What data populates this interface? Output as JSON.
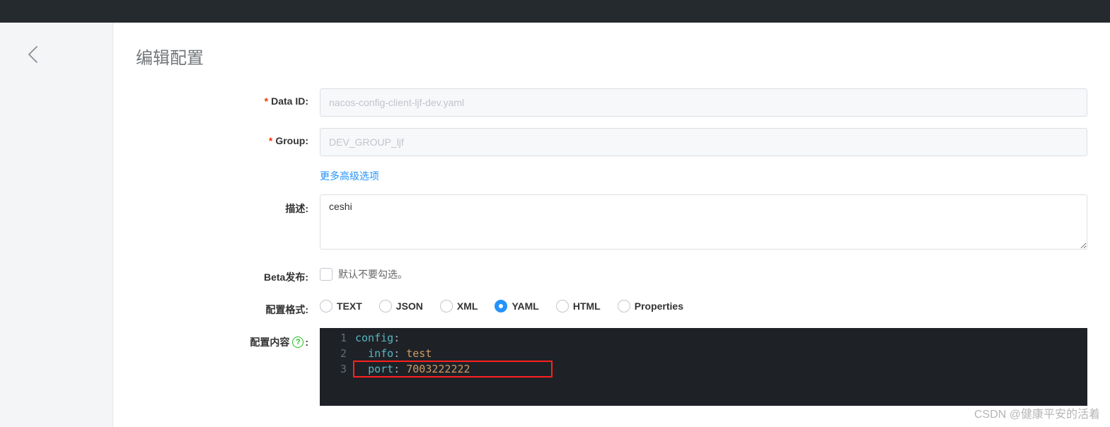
{
  "page": {
    "title": "编辑配置"
  },
  "form": {
    "dataId": {
      "label": "Data ID:",
      "value": "nacos-config-client-ljf-dev.yaml"
    },
    "group": {
      "label": "Group:",
      "value": "DEV_GROUP_ljf"
    },
    "advancedLink": "更多高级选项",
    "description": {
      "label": "描述:",
      "value": "ceshi"
    },
    "beta": {
      "label": "Beta发布:",
      "hint": "默认不要勾选。"
    },
    "format": {
      "label": "配置格式:",
      "options": [
        {
          "value": "TEXT",
          "checked": false
        },
        {
          "value": "JSON",
          "checked": false
        },
        {
          "value": "XML",
          "checked": false
        },
        {
          "value": "YAML",
          "checked": true
        },
        {
          "value": "HTML",
          "checked": false
        },
        {
          "value": "Properties",
          "checked": false
        }
      ]
    },
    "content": {
      "label": "配置内容",
      "helpSuffix": ":",
      "lines": [
        {
          "n": "1",
          "tokens": [
            {
              "t": "config",
              "c": "kw"
            },
            {
              "t": ":",
              "c": "colon"
            }
          ]
        },
        {
          "n": "2",
          "tokens": [
            {
              "t": "  ",
              "c": ""
            },
            {
              "t": "info",
              "c": "kw"
            },
            {
              "t": ": ",
              "c": "colon"
            },
            {
              "t": "test",
              "c": "val"
            }
          ]
        },
        {
          "n": "3",
          "tokens": [
            {
              "t": "  ",
              "c": ""
            },
            {
              "t": "port",
              "c": "kw"
            },
            {
              "t": ": ",
              "c": "colon"
            },
            {
              "t": "7003222222",
              "c": "num"
            }
          ]
        }
      ]
    }
  },
  "watermark": "CSDN @健康平安的活着"
}
